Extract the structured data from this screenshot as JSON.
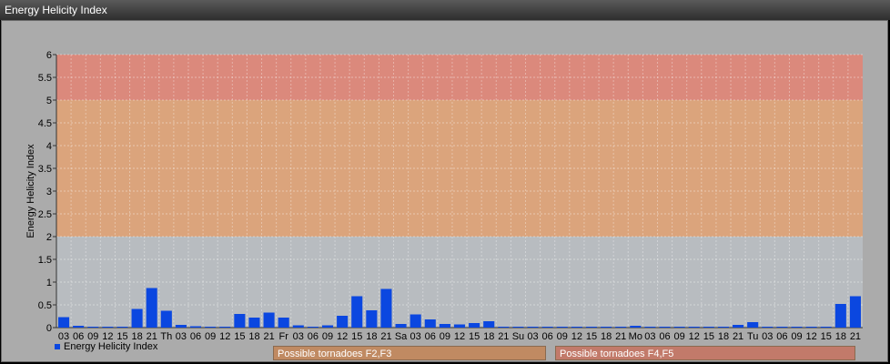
{
  "window": {
    "title": "Energy Helicity Index"
  },
  "legend": {
    "series_label": "Energy Helicity Index"
  },
  "bands": [
    {
      "label": "Possible tornadoes F2,F3",
      "from": 2,
      "to": 5,
      "color": "#e0a070",
      "label_bg": "#c08a62"
    },
    {
      "label": "Possible tornadoes F4,F5",
      "from": 5,
      "to": 6,
      "color": "#e08070",
      "label_bg": "#c27a6a"
    }
  ],
  "chart_data": {
    "type": "bar",
    "ylabel": "Energy Helicity Index",
    "ylim": [
      0,
      6
    ],
    "yticks": [
      "0",
      "0.5",
      "1",
      "1.5",
      "2",
      "2.5",
      "3",
      "3.5",
      "4",
      "4.5",
      "5",
      "5.5",
      "6"
    ],
    "categories": [
      "03",
      "06",
      "09",
      "12",
      "15",
      "18",
      "21",
      "Th",
      "03",
      "06",
      "09",
      "12",
      "15",
      "18",
      "21",
      "Fr",
      "03",
      "06",
      "09",
      "12",
      "15",
      "18",
      "21",
      "Sa",
      "03",
      "06",
      "09",
      "12",
      "15",
      "18",
      "21",
      "Su",
      "03",
      "06",
      "09",
      "12",
      "15",
      "18",
      "21",
      "Mo",
      "03",
      "06",
      "09",
      "12",
      "15",
      "18",
      "21",
      "Tu",
      "03",
      "06",
      "09",
      "12",
      "15",
      "18",
      "21"
    ],
    "series": [
      {
        "name": "Energy Helicity Index",
        "color": "#0b47e0",
        "values": [
          0.23,
          0.04,
          0.02,
          0.02,
          0.02,
          0.41,
          0.87,
          0.37,
          0.06,
          0.03,
          0.02,
          0.02,
          0.3,
          0.22,
          0.33,
          0.22,
          0.05,
          0.02,
          0.05,
          0.26,
          0.69,
          0.38,
          0.85,
          0.08,
          0.29,
          0.18,
          0.08,
          0.07,
          0.1,
          0.14,
          0.02,
          0.02,
          0.02,
          0.02,
          0.02,
          0.02,
          0.02,
          0.02,
          0.02,
          0.04,
          0.02,
          0.02,
          0.02,
          0.02,
          0.02,
          0.02,
          0.06,
          0.12,
          0.02,
          0.02,
          0.02,
          0.02,
          0.02,
          0.52,
          0.69
        ]
      }
    ],
    "grid": true
  }
}
